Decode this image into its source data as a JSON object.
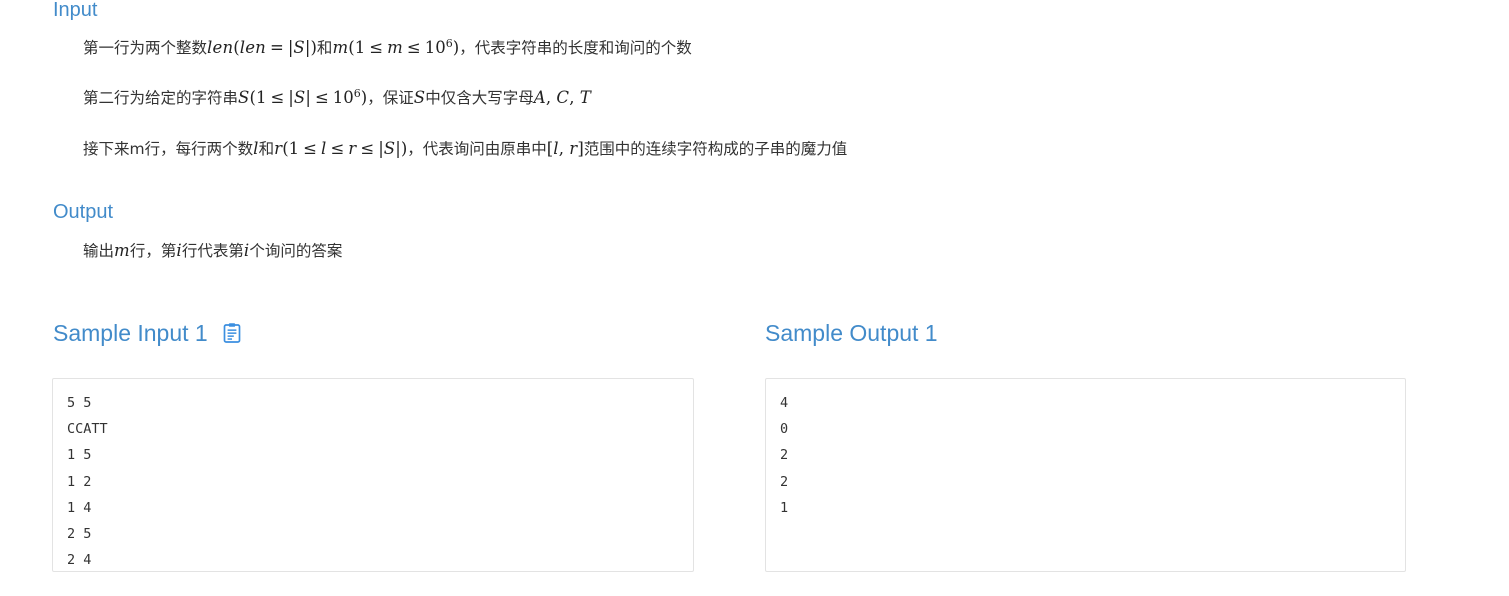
{
  "sections": {
    "input": {
      "heading": "Input",
      "lines": [
        {
          "parts": [
            {
              "t": "text",
              "v": "第一行为两个整数"
            },
            {
              "t": "math",
              "v": "len"
            },
            {
              "t": "mn",
              "v": "("
            },
            {
              "t": "math",
              "v": "len"
            },
            {
              "t": "op",
              "v": "="
            },
            {
              "t": "mn",
              "v": "|"
            },
            {
              "t": "math",
              "v": "S"
            },
            {
              "t": "mn",
              "v": "|)"
            },
            {
              "t": "text",
              "v": "和"
            },
            {
              "t": "math",
              "v": "m"
            },
            {
              "t": "mn",
              "v": "(1"
            },
            {
              "t": "op",
              "v": "≤"
            },
            {
              "t": "math",
              "v": "m"
            },
            {
              "t": "op",
              "v": "≤"
            },
            {
              "t": "mn",
              "v": "10"
            },
            {
              "t": "sup",
              "v": "6"
            },
            {
              "t": "mn",
              "v": ")"
            },
            {
              "t": "text",
              "v": "，代表字符串的长度和询问的个数"
            }
          ]
        },
        {
          "parts": [
            {
              "t": "text",
              "v": "第二行为给定的字符串"
            },
            {
              "t": "math",
              "v": "S"
            },
            {
              "t": "mn",
              "v": "(1"
            },
            {
              "t": "op",
              "v": "≤"
            },
            {
              "t": "mn",
              "v": "|"
            },
            {
              "t": "math",
              "v": "S"
            },
            {
              "t": "mn",
              "v": "|"
            },
            {
              "t": "op",
              "v": "≤"
            },
            {
              "t": "mn",
              "v": "10"
            },
            {
              "t": "sup",
              "v": "6"
            },
            {
              "t": "mn",
              "v": ")"
            },
            {
              "t": "text",
              "v": "，保证"
            },
            {
              "t": "math",
              "v": "S"
            },
            {
              "t": "text",
              "v": "中仅含大写字母"
            },
            {
              "t": "math",
              "v": "A"
            },
            {
              "t": "mn",
              "v": ", "
            },
            {
              "t": "math",
              "v": "C"
            },
            {
              "t": "mn",
              "v": ", "
            },
            {
              "t": "math",
              "v": "T"
            }
          ]
        },
        {
          "parts": [
            {
              "t": "text",
              "v": "接下来m行，每行两个数"
            },
            {
              "t": "math",
              "v": "l"
            },
            {
              "t": "text",
              "v": "和"
            },
            {
              "t": "math",
              "v": "r"
            },
            {
              "t": "mn",
              "v": "(1"
            },
            {
              "t": "op",
              "v": "≤"
            },
            {
              "t": "math",
              "v": "l"
            },
            {
              "t": "op",
              "v": "≤"
            },
            {
              "t": "math",
              "v": "r"
            },
            {
              "t": "op",
              "v": "≤"
            },
            {
              "t": "mn",
              "v": "|"
            },
            {
              "t": "math",
              "v": "S"
            },
            {
              "t": "mn",
              "v": "|)"
            },
            {
              "t": "text",
              "v": "，代表询问由原串中"
            },
            {
              "t": "mn",
              "v": "["
            },
            {
              "t": "math",
              "v": "l"
            },
            {
              "t": "mn",
              "v": ", "
            },
            {
              "t": "math",
              "v": "r"
            },
            {
              "t": "mn",
              "v": "]"
            },
            {
              "t": "text",
              "v": "范围中的连续字符构成的子串的魔力值"
            }
          ]
        }
      ]
    },
    "output": {
      "heading": "Output",
      "lines": [
        {
          "parts": [
            {
              "t": "text",
              "v": "输出"
            },
            {
              "t": "math",
              "v": "m"
            },
            {
              "t": "text",
              "v": "行，第"
            },
            {
              "t": "math",
              "v": "i"
            },
            {
              "t": "text",
              "v": "行代表第"
            },
            {
              "t": "math",
              "v": "i"
            },
            {
              "t": "text",
              "v": "个询问的答案"
            }
          ]
        }
      ]
    }
  },
  "samples": {
    "input": {
      "heading": "Sample Input 1",
      "copy_icon": "clipboard-copy-icon",
      "content": "5 5\nCCATT\n1 5\n1 2\n1 4\n2 5\n2 4"
    },
    "output": {
      "heading": "Sample Output 1",
      "content": "4\n0\n2\n2\n1"
    }
  },
  "colors": {
    "heading_blue": "#428bca",
    "body_text": "#333333",
    "box_border": "#e3e3e3",
    "page_background": "#ffffff"
  }
}
